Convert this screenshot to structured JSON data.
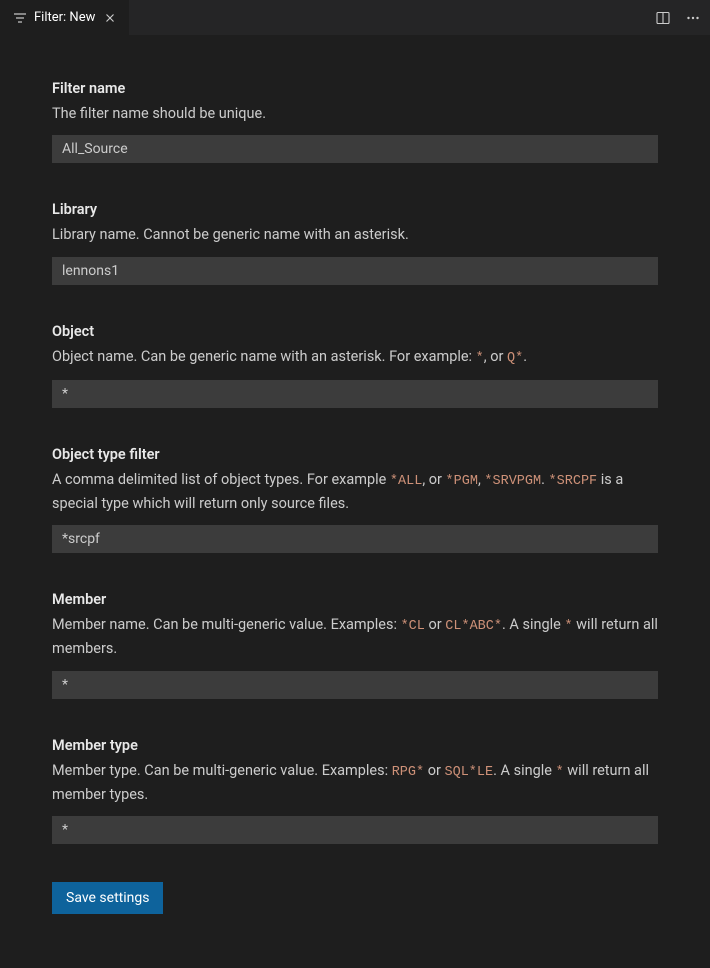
{
  "tab": {
    "title": "Filter: New"
  },
  "fields": {
    "filterName": {
      "label": "Filter name",
      "desc": "The filter name should be unique.",
      "value": "All_Source"
    },
    "library": {
      "label": "Library",
      "desc": "Library name. Cannot be generic name with an asterisk.",
      "value": "lennons1"
    },
    "object": {
      "label": "Object",
      "descPrefix": "Object name. Can be generic name with an asterisk. For example: ",
      "code1": "*",
      "descMid": ", or ",
      "code2": "Q*",
      "descSuffix": ".",
      "value": "*"
    },
    "objectTypeFilter": {
      "label": "Object type filter",
      "descPrefix": "A comma delimited list of object types. For example ",
      "code1": "*ALL",
      "descMid1": ", or ",
      "code2": "*PGM",
      "descMid2": ", ",
      "code3": "*SRVPGM",
      "descMid3": ". ",
      "code4": "*SRCPF",
      "descSuffix": " is a special type which will return only source files.",
      "value": "*srcpf"
    },
    "member": {
      "label": "Member",
      "descPrefix": "Member name. Can be multi-generic value. Examples: ",
      "code1": "*CL",
      "descMid1": " or ",
      "code2": "CL*ABC*",
      "descMid2": ". A single ",
      "code3": "*",
      "descSuffix": " will return all members.",
      "value": "*"
    },
    "memberType": {
      "label": "Member type",
      "descPrefix": "Member type. Can be multi-generic value. Examples: ",
      "code1": "RPG*",
      "descMid1": " or ",
      "code2": "SQL*LE",
      "descMid2": ". A single ",
      "code3": "*",
      "descSuffix": " will return all member types.",
      "value": "*"
    }
  },
  "saveButton": "Save settings"
}
